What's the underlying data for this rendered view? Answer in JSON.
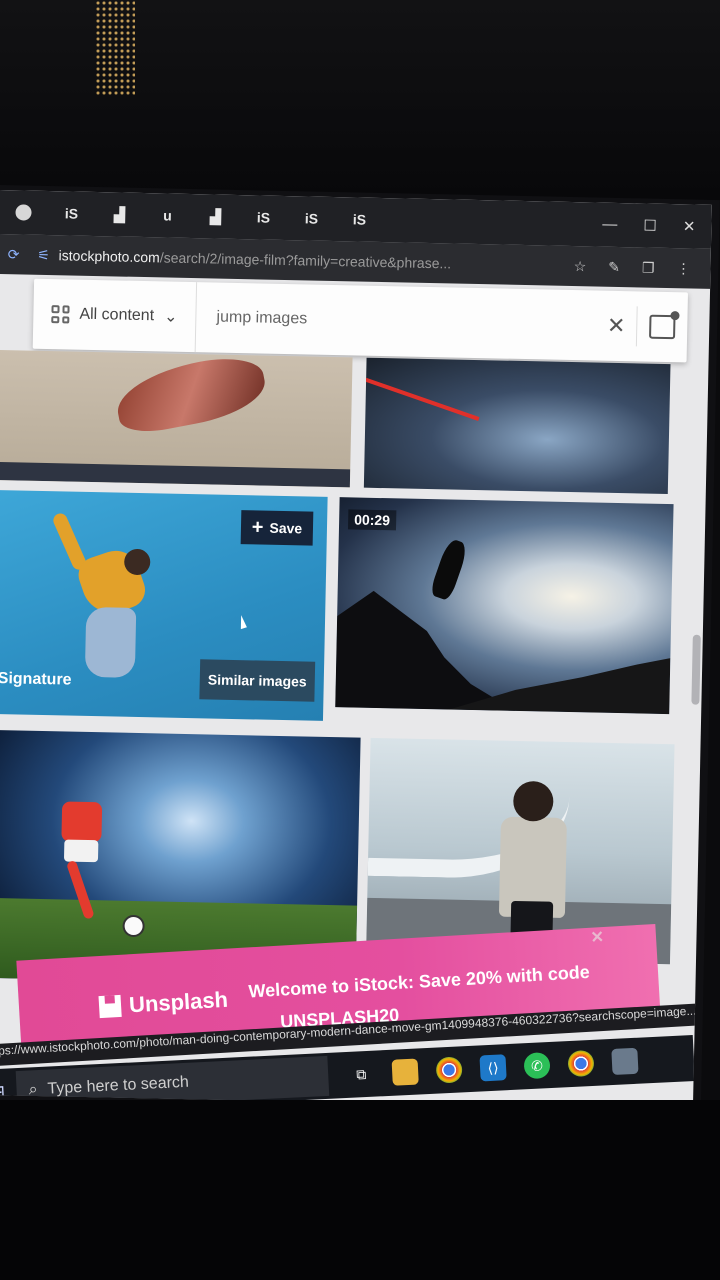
{
  "browser": {
    "tabs": [
      {
        "label": "",
        "icon": "profile-dot-icon"
      },
      {
        "label": "iS",
        "icon": "istock-tab-icon"
      },
      {
        "label": "",
        "icon": "unsplash-tab-icon"
      },
      {
        "label": "u",
        "icon": "tab-icon"
      },
      {
        "label": "",
        "icon": "unsplash-tab-icon"
      },
      {
        "label": "iS",
        "icon": "istock-tab-icon"
      },
      {
        "label": "iS",
        "icon": "istock-tab-icon"
      },
      {
        "label": "iS",
        "icon": "istock-tab-icon"
      }
    ],
    "url_host": "istockphoto.com",
    "url_path": "/search/2/image-film?family=creative&phrase..."
  },
  "search": {
    "content_filter": "All content",
    "query": "jump images"
  },
  "tiles": {
    "save_label": "Save",
    "similar_label": "Similar images",
    "signature_label": "Signature",
    "video_duration": "00:29"
  },
  "promo": {
    "brand": "Unsplash",
    "message": "Welcome to iStock: Save 20% with code",
    "code": "UNSPLASH20"
  },
  "status_url": "https://www.istockphoto.com/photo/man-doing-contemporary-modern-dance-move-gm1409948376-460322736?searchscope=image...",
  "taskbar": {
    "search_placeholder": "Type here to search"
  },
  "colors": {
    "accent_navy": "#16243a",
    "promo_pink": "#e14a96"
  }
}
